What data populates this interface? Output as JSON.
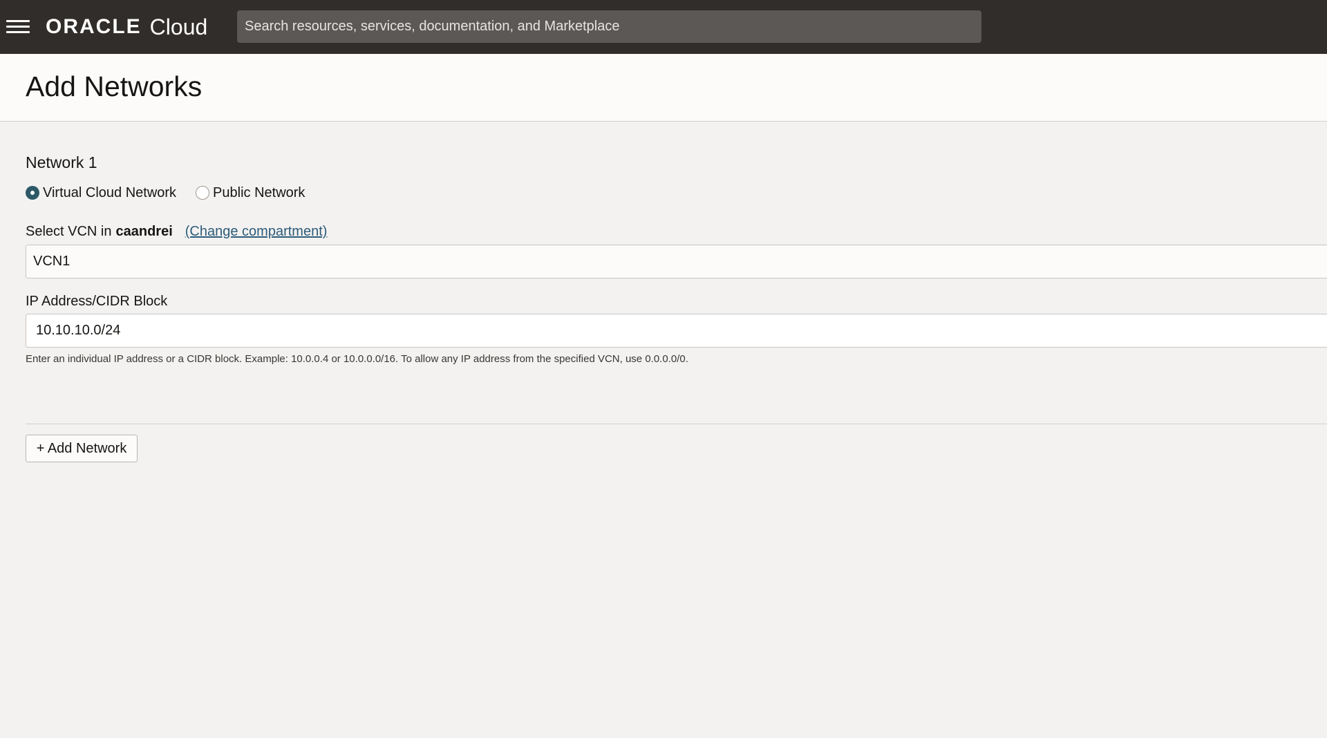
{
  "header": {
    "brand": "ORACLE",
    "product": "Cloud",
    "menu_icon": "hamburger-menu-icon",
    "search_placeholder": "Search resources, services, documentation, and Marketplace",
    "search_value": ""
  },
  "page": {
    "title": "Add Networks"
  },
  "network": {
    "title": "Network 1",
    "type_options": [
      {
        "label": "Virtual Cloud Network",
        "selected": true
      },
      {
        "label": "Public Network",
        "selected": false
      }
    ],
    "vcn_label_prefix": "Select VCN in",
    "compartment": "caandrei",
    "change_compartment_label": "(Change compartment)",
    "vcn_selected": "VCN1",
    "cidr_label": "IP Address/CIDR Block",
    "cidr_value": "10.10.10.0/24",
    "cidr_help": "Enter an individual IP address or a CIDR block. Example: 10.0.0.4 or 10.0.0.0/16. To allow any IP address from the specified VCN, use 0.0.0.0/0."
  },
  "actions": {
    "add_network_label": "+ Add Network"
  },
  "colors": {
    "topbar": "#312d2a",
    "search_bg": "#5c5855",
    "background": "#f3f2f1",
    "radio_selected": "#2d5967",
    "link": "#2c5b78"
  }
}
